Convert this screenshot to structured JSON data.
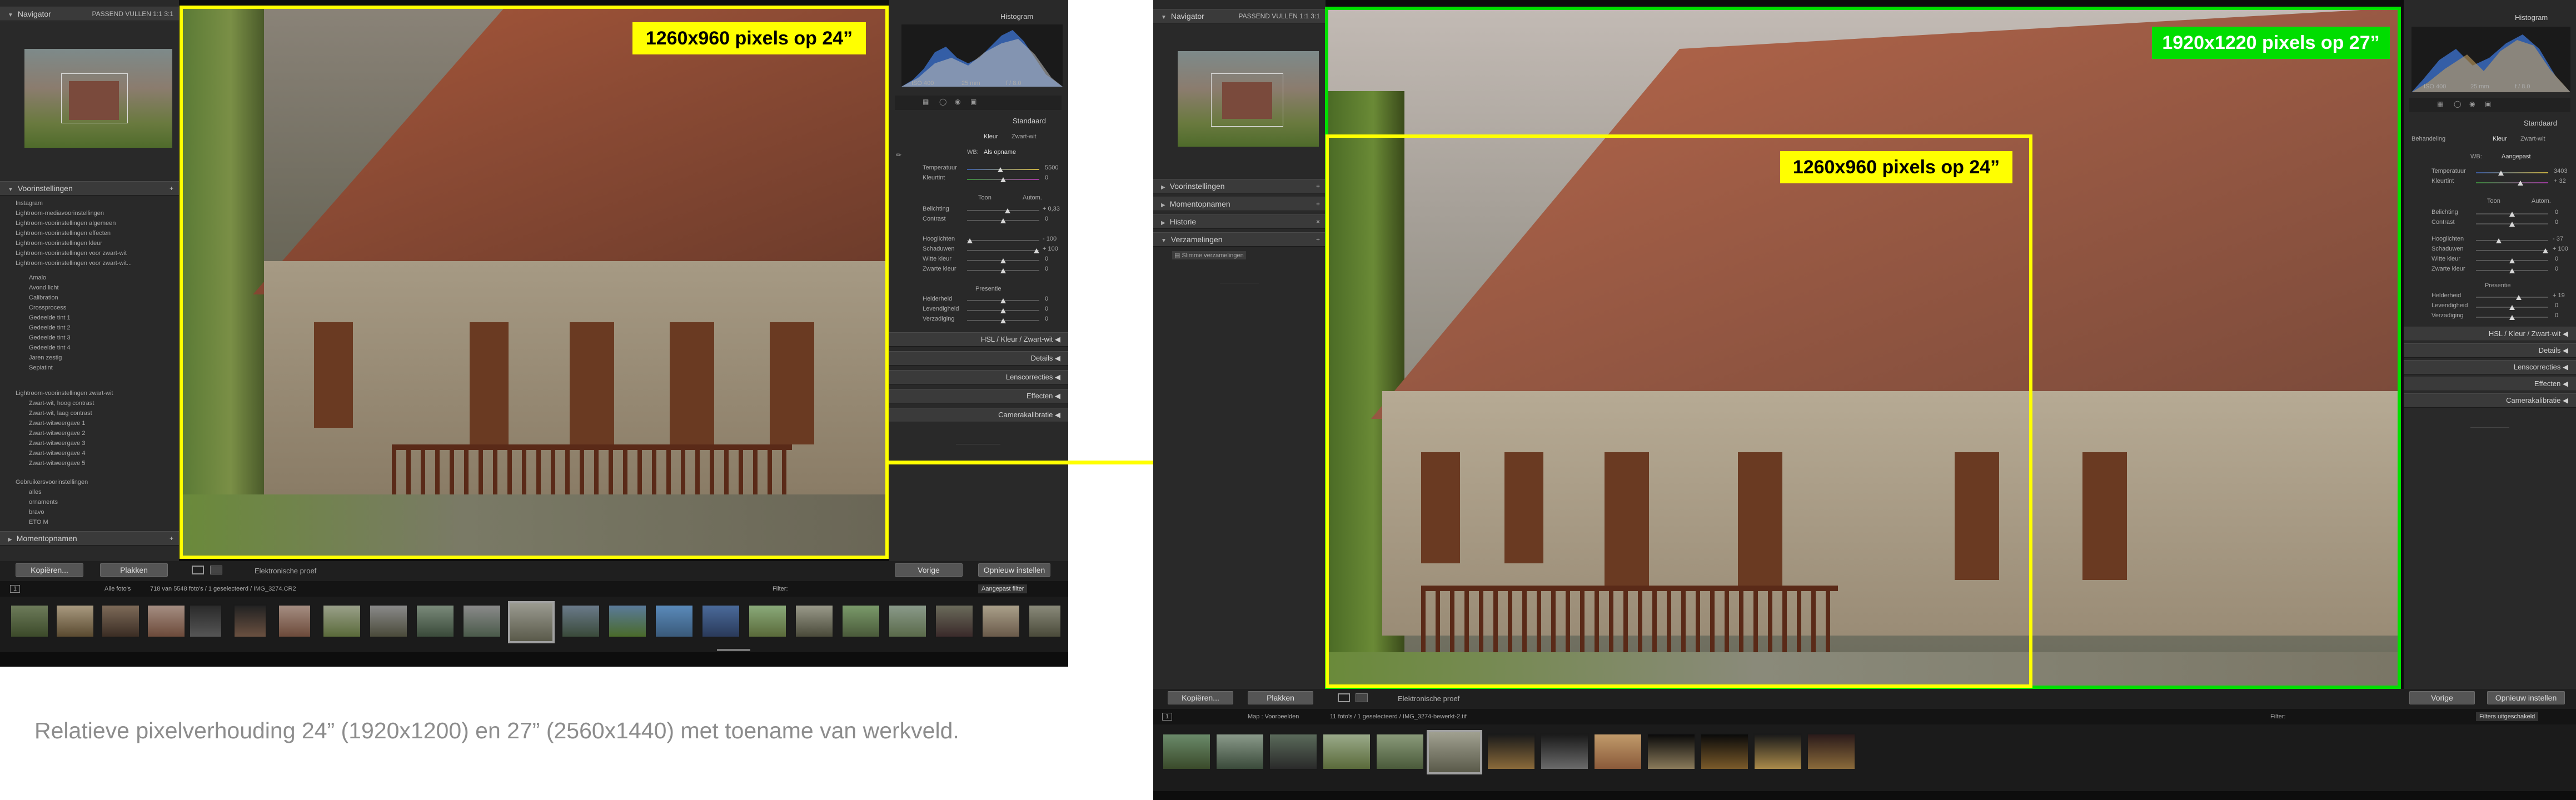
{
  "caption": "Relatieve pixelverhouding 24” (1920x1200) en 27” (2560x1440) met toename van werkveld.",
  "labels": {
    "left_frame": "1260x960 pixels op 24”",
    "right_big_frame": "1920x1220 pixels op 27”",
    "right_small_frame": "1260x960 pixels op 24”"
  },
  "colors": {
    "frame_yellow": "#ffff00",
    "frame_green": "#00e000"
  },
  "left": {
    "navigator": {
      "title": "Navigator",
      "zoom": "PASSEND   VULLEN   1:1   3:1"
    },
    "presets": {
      "title": "Voorinstellingen",
      "items": [
        "Instagram",
        "Lightroom-mediavoorinstellingen",
        "Lightroom-voorinstellingen algemeen",
        "Lightroom-voorinstellingen effecten",
        "Lightroom-voorinstellingen kleur",
        "Lightroom-voorinstellingen voor zwart-wit",
        "Lightroom-voorinstellingen voor zwart-wit...",
        "Amalo",
        "Avond licht",
        "Calibration",
        "Crossprocess",
        "Gedeelde tint 1",
        "Gedeelde tint 2",
        "Gedeelde tint 3",
        "Gedeelde tint 4",
        "Jaren zestig",
        "Sepiatint",
        "Lightroom-voorinstellingen zwart-wit",
        "Zwart-wit, hoog contrast",
        "Zwart-wit, laag contrast",
        "Zwart-witweergave 1",
        "Zwart-witweergave 2",
        "Zwart-witweergave 3",
        "Zwart-witweergave 4",
        "Zwart-witweergave 5",
        "Gebruikersvoorinstellingen",
        "alles",
        "ornaments",
        "bravo",
        "ETO M"
      ]
    },
    "snapshots": "Momentopnamen",
    "buttons": {
      "copy": "Kopiëren...",
      "paste": "Plakken",
      "proof": "Elektronische proef",
      "prev": "Vorige",
      "reset": "Opnieuw instellen"
    },
    "histogram": {
      "title": "Histogram",
      "iso": "ISO 400",
      "focal": "25 mm",
      "aperture": "f / 8.0"
    },
    "basic": {
      "title": "Standaard",
      "treatment": [
        "Kleur",
        "Zwart-wit"
      ],
      "wb_label": "WB:",
      "wb_value": "Als opname",
      "rows": [
        {
          "label": "Temperatuur",
          "value": "5500"
        },
        {
          "label": "Kleurtint",
          "value": "0"
        },
        {
          "label": "Belichting",
          "value": "+ 0,33"
        },
        {
          "label": "Contrast",
          "value": "0"
        },
        {
          "label": "Hooglichten",
          "value": "- 100"
        },
        {
          "label": "Schaduwen",
          "value": "+ 100"
        },
        {
          "label": "Witte kleur",
          "value": "0"
        },
        {
          "label": "Zwarte kleur",
          "value": "0"
        },
        {
          "label": "Helderheid",
          "value": "0"
        },
        {
          "label": "Levendigheid",
          "value": "0"
        },
        {
          "label": "Verzadiging",
          "value": "0"
        }
      ],
      "tone": "Toon",
      "auto": "Autom.",
      "presence": "Presentie"
    },
    "sections": [
      "HSL  /  Kleur  /  Zwart-wit",
      "Details",
      "Lenscorrecties",
      "Effecten",
      "Camerakalibratie"
    ],
    "filmstrip_bar": {
      "page": "1",
      "all_photos": "Alle foto's",
      "count": "718 van 5548 foto's / 1 geselecteerd / IMG_3274.CR2",
      "filter": "Filter:",
      "filter_value": "Aangepast filter"
    }
  },
  "right": {
    "navigator": {
      "title": "Navigator",
      "zoom": "PASSEND   VULLEN   1:1   3:1"
    },
    "panels": [
      "Voorinstellingen",
      "Momentopnamen",
      "Historie",
      "Verzamelingen"
    ],
    "collection_item": "Slimme verzamelingen",
    "buttons": {
      "copy": "Kopiëren...",
      "paste": "Plakken",
      "proof": "Elektronische proef",
      "prev": "Vorige",
      "reset": "Opnieuw instellen"
    },
    "histogram": {
      "title": "Histogram",
      "iso": "ISO 400",
      "focal": "25 mm",
      "aperture": "f / 8.0"
    },
    "basic": {
      "title": "Standaard",
      "treatment": [
        "Behandeling",
        "Kleur",
        "Zwart-wit"
      ],
      "wb_label": "WB:",
      "wb_value": "Aangepast",
      "rows": [
        {
          "label": "Temperatuur",
          "value": "3403"
        },
        {
          "label": "Kleurtint",
          "value": "+ 32"
        },
        {
          "label": "Belichting",
          "value": "0"
        },
        {
          "label": "Contrast",
          "value": "0"
        },
        {
          "label": "Hooglichten",
          "value": "- 37"
        },
        {
          "label": "Schaduwen",
          "value": "+ 100"
        },
        {
          "label": "Witte kleur",
          "value": "0"
        },
        {
          "label": "Zwarte kleur",
          "value": "0"
        },
        {
          "label": "Helderheid",
          "value": "+ 19"
        },
        {
          "label": "Levendigheid",
          "value": "0"
        },
        {
          "label": "Verzadiging",
          "value": "0"
        }
      ],
      "tone": "Toon",
      "auto": "Autom.",
      "presence": "Presentie"
    },
    "sections": [
      "HSL  /  Kleur  /  Zwart-wit",
      "Details",
      "Lenscorrecties",
      "Effecten",
      "Camerakalibratie"
    ],
    "filmstrip_bar": {
      "page": "1",
      "folder": "Map : Voorbeelden",
      "count": "11 foto's / 1 geselecteerd / IMG_3274-bewerkt-2.tif",
      "filter": "Filter:",
      "filter_value": "Filters uitgeschakeld"
    }
  }
}
